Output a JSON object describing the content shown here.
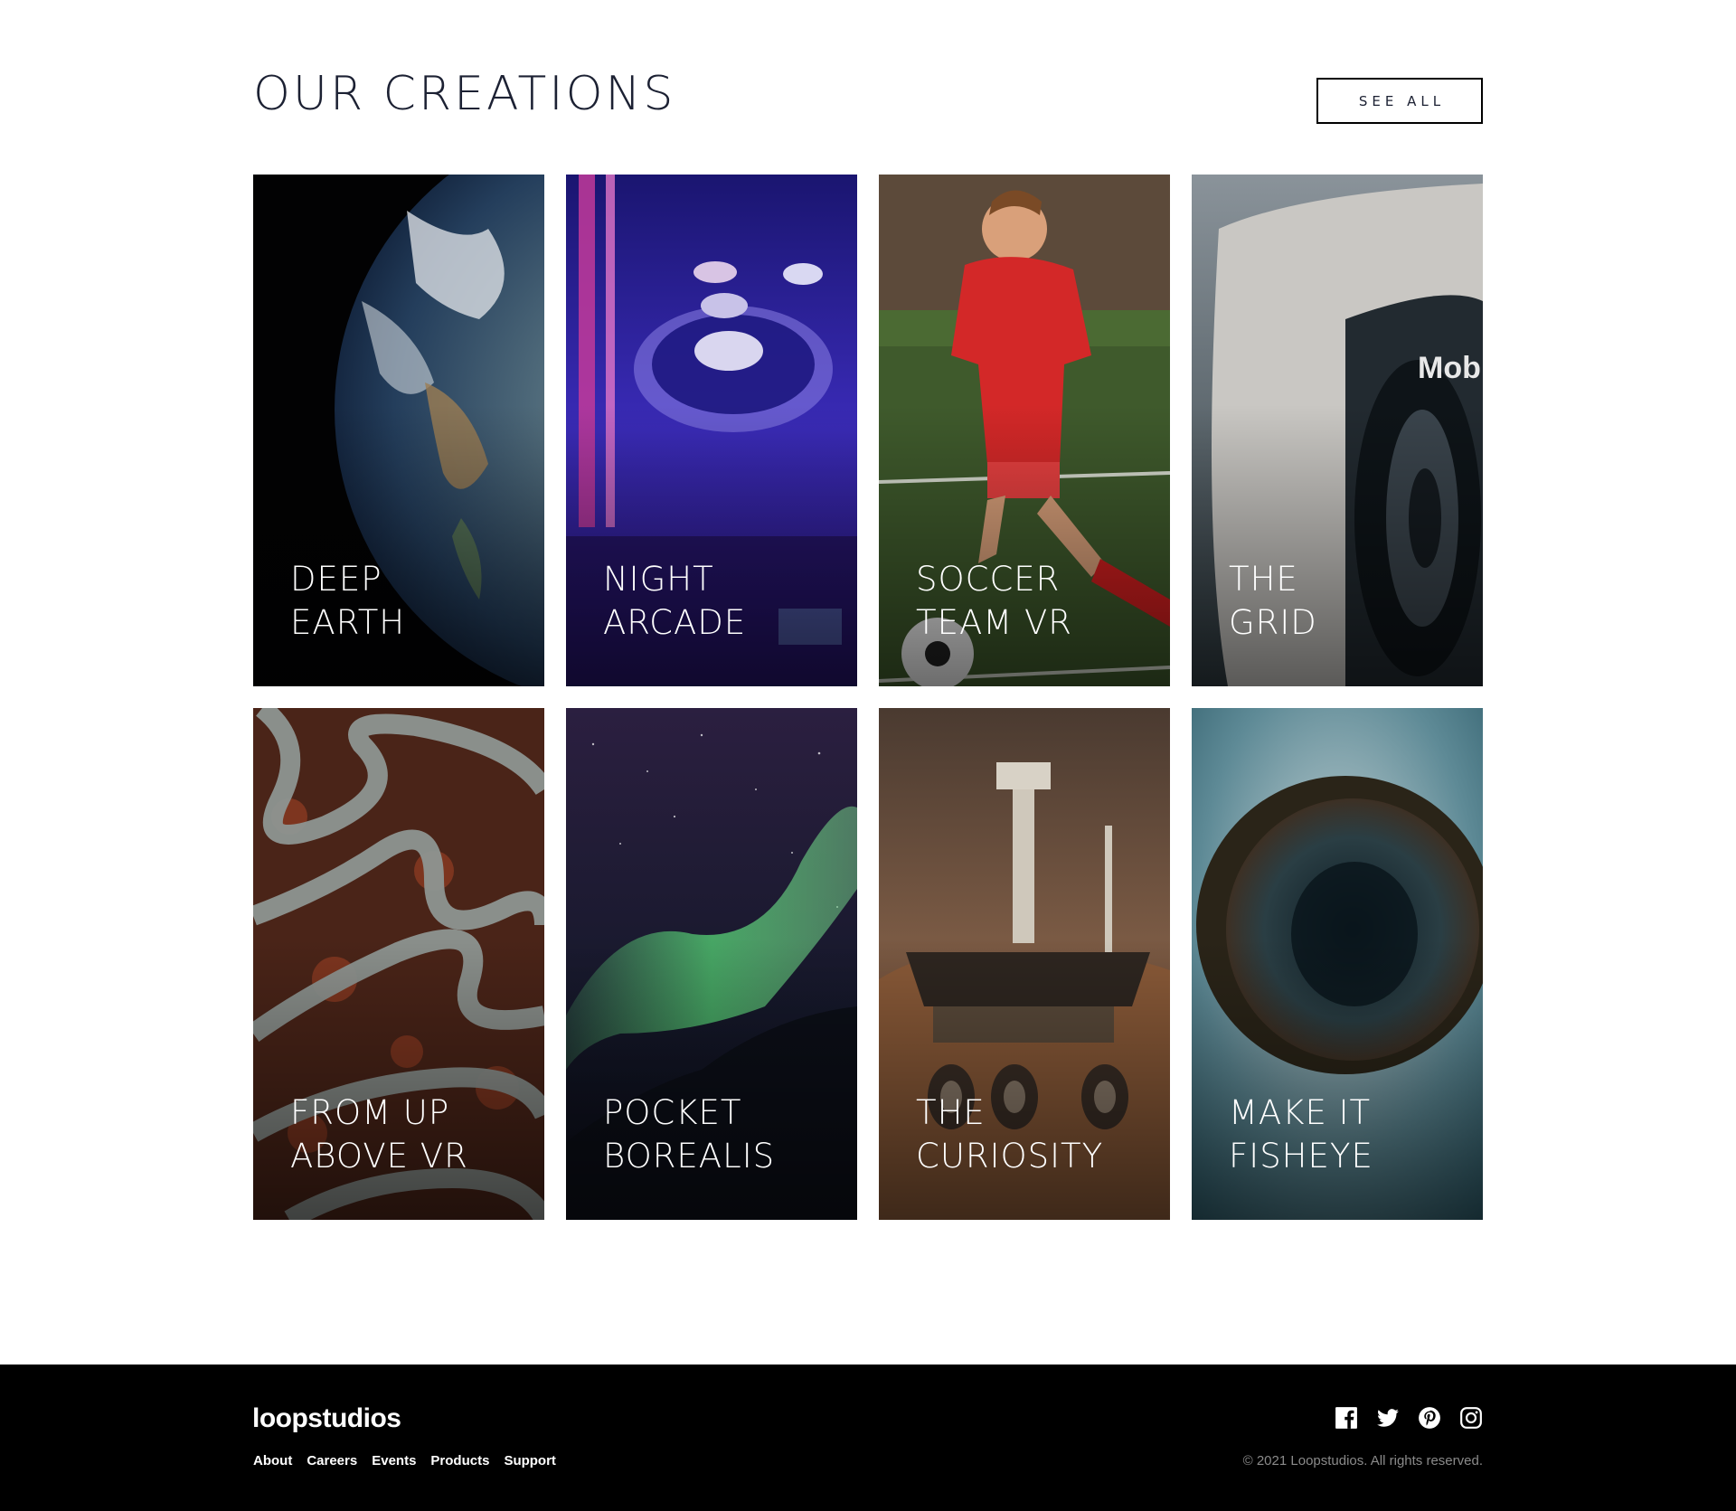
{
  "creations": {
    "title": "OUR CREATIONS",
    "see_all_label": "SEE ALL",
    "cards": [
      {
        "line1": "DEEP",
        "line2": "EARTH",
        "image": "earth-from-space"
      },
      {
        "line1": "NIGHT",
        "line2": "ARCADE",
        "image": "skee-ball-arcade"
      },
      {
        "line1": "SOCCER",
        "line2": "TEAM VR",
        "image": "soccer-player"
      },
      {
        "line1": "THE",
        "line2": "GRID",
        "image": "race-car"
      },
      {
        "line1": "FROM UP",
        "line2": "ABOVE VR",
        "image": "winding-roads-aerial"
      },
      {
        "line1": "POCKET",
        "line2": "BOREALIS",
        "image": "northern-lights"
      },
      {
        "line1": "THE",
        "line2": "CURIOSITY",
        "image": "mars-rover"
      },
      {
        "line1": "MAKE IT",
        "line2": "FISHEYE",
        "image": "fisheye-globe"
      }
    ]
  },
  "footer": {
    "logo": "loopstudios",
    "nav": [
      "About",
      "Careers",
      "Events",
      "Products",
      "Support"
    ],
    "social": [
      "facebook-icon",
      "twitter-icon",
      "pinterest-icon",
      "instagram-icon"
    ],
    "copyright": "© 2021 Loopstudios. All rights reserved."
  },
  "colors": {
    "heading": "#1c2133",
    "footer_bg": "#000000",
    "copyright": "#8a8a8a"
  }
}
